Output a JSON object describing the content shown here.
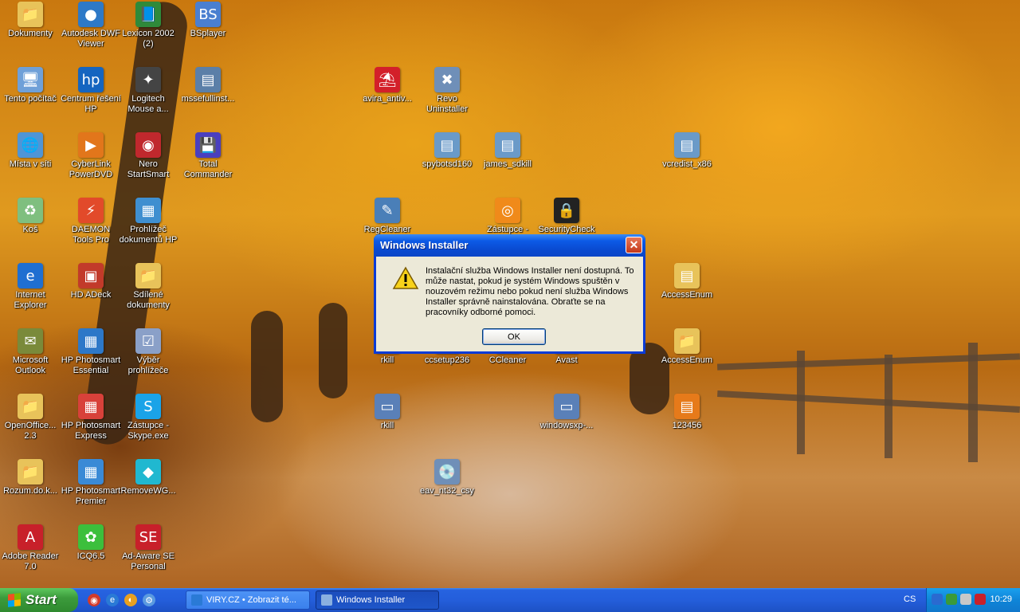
{
  "desktop": {
    "icons": [
      {
        "label": "Dokumenty",
        "glyph": "📁",
        "color": "#e8c35a"
      },
      {
        "label": "Autodesk DWF Viewer",
        "glyph": "●",
        "color": "#2d79c7"
      },
      {
        "label": "Lexicon 2002 (2)",
        "glyph": "📘",
        "color": "#2f8a3a"
      },
      {
        "label": "BSplayer",
        "glyph": "BS",
        "color": "#4a7fd0"
      },
      {
        "label": "Tento počítač",
        "glyph": "🖥",
        "color": "#6fa0d8"
      },
      {
        "label": "Centrum řešení HP",
        "glyph": "hp",
        "color": "#1565c0"
      },
      {
        "label": "Logitech Mouse a...",
        "glyph": "✦",
        "color": "#444444"
      },
      {
        "label": "mssefullinst...",
        "glyph": "▤",
        "color": "#5b7fa8"
      },
      {
        "label": "Místa v síti",
        "glyph": "🌐",
        "color": "#4f95d6"
      },
      {
        "label": "CyberLink PowerDVD",
        "glyph": "▶",
        "color": "#e2761b"
      },
      {
        "label": "Nero StartSmart",
        "glyph": "◉",
        "color": "#c0282d"
      },
      {
        "label": "Total Commander",
        "glyph": "💾",
        "color": "#4a3fbf"
      },
      {
        "label": "Koš",
        "glyph": "♻",
        "color": "#7fbf7f"
      },
      {
        "label": "DAEMON Tools Pro",
        "glyph": "⚡",
        "color": "#e24a2a"
      },
      {
        "label": "Prohlížeč dokumentů HP",
        "glyph": "▦",
        "color": "#3f8fd0"
      },
      {
        "label": "Internet Explorer",
        "glyph": "e",
        "color": "#1f6fd1"
      },
      {
        "label": "HD ADeck",
        "glyph": "▣",
        "color": "#c23a2a"
      },
      {
        "label": "Sdílené dokumenty",
        "glyph": "📁",
        "color": "#e8c35a"
      },
      {
        "label": "Microsoft Outlook",
        "glyph": "✉",
        "color": "#7a8a3a"
      },
      {
        "label": "HP Photosmart Essential",
        "glyph": "▦",
        "color": "#2d78c8"
      },
      {
        "label": "Výběr prohlížeče",
        "glyph": "☑",
        "color": "#8aa0c8"
      },
      {
        "label": "OpenOffice... 2.3",
        "glyph": "📁",
        "color": "#e8c35a"
      },
      {
        "label": "HP Photosmart Express",
        "glyph": "▦",
        "color": "#d8413a"
      },
      {
        "label": "Zástupce - Skype.exe",
        "glyph": "S",
        "color": "#1aa3e8"
      },
      {
        "label": "Rozum.do.k...",
        "glyph": "📁",
        "color": "#e8c35a"
      },
      {
        "label": "HP Photosmart Premier",
        "glyph": "▦",
        "color": "#3a8ad6"
      },
      {
        "label": "RemoveWG...",
        "glyph": "◆",
        "color": "#20b8d0"
      },
      {
        "label": "Adobe Reader 7.0",
        "glyph": "A",
        "color": "#c8202a"
      },
      {
        "label": "ICQ6.5",
        "glyph": "✿",
        "color": "#3cbf3c"
      },
      {
        "label": "Ad-Aware SE Personal",
        "glyph": "SE",
        "color": "#c8202a"
      },
      {
        "label": "avira_antiv...",
        "glyph": "⛱",
        "color": "#d3202a"
      },
      {
        "label": "Revo Uninstaller",
        "glyph": "✖",
        "color": "#6f8fb8"
      },
      {
        "label": "spybotsd160",
        "glyph": "▤",
        "color": "#6a9ac8"
      },
      {
        "label": "james_sdkill",
        "glyph": "▤",
        "color": "#6a9ac8"
      },
      {
        "label": "vcredist_x86",
        "glyph": "▤",
        "color": "#6a9ac8"
      },
      {
        "label": "RegCleaner",
        "glyph": "✎",
        "color": "#4a7fb8"
      },
      {
        "label": "Zástupce -",
        "glyph": "◎",
        "color": "#f08a1a"
      },
      {
        "label": "SecurityCheck",
        "glyph": "🔒",
        "color": "#222222"
      },
      {
        "label": "avg...",
        "glyph": "▤",
        "color": "#6a9ac8"
      },
      {
        "label": "AccessEnum",
        "glyph": "▤",
        "color": "#e8c35a"
      },
      {
        "label": "rkill",
        "glyph": "▭",
        "color": "#5a80b8"
      },
      {
        "label": "ccsetup236",
        "glyph": "▤",
        "color": "#6a9ac8"
      },
      {
        "label": "CCleaner",
        "glyph": "▤",
        "color": "#6a9ac8"
      },
      {
        "label": "Avast",
        "glyph": "▤",
        "color": "#6a9ac8"
      },
      {
        "label": "AccessEnum",
        "glyph": "📁",
        "color": "#e8c35a"
      },
      {
        "label": "rkill",
        "glyph": "▭",
        "color": "#5a80b8"
      },
      {
        "label": "windowsxp-...",
        "glyph": "▭",
        "color": "#5a80b8"
      },
      {
        "label": "123456",
        "glyph": "▤",
        "color": "#e67a1a"
      },
      {
        "label": "eav_nt32_csy",
        "glyph": "💿",
        "color": "#6f8fb8"
      }
    ]
  },
  "dialog": {
    "title": "Windows Installer",
    "message": "Instalační služba Windows Installer není dostupná. To může nastat, pokud je systém Windows spuštěn v nouzovém režimu nebo pokud není služba Windows Installer správně nainstalována. Obraťte se na pracovníky odborné pomoci.",
    "ok_label": "OK",
    "close_glyph": "✕",
    "warning_icon": "warning-icon"
  },
  "taskbar": {
    "start_label": "Start",
    "quick_launch": [
      {
        "glyph": "◉",
        "color": "#d33a2a"
      },
      {
        "glyph": "e",
        "color": "#2a7ad6"
      },
      {
        "glyph": "◐",
        "color": "#e8a020"
      },
      {
        "glyph": "⚙",
        "color": "#5a9ae0"
      }
    ],
    "tasks": [
      {
        "label": "VIRY.CZ • Zobrazit té..."
      },
      {
        "label": "Windows Installer"
      }
    ],
    "language": "CS",
    "clock": "10:29",
    "tray_icons": [
      {
        "name": "chevron-left-icon",
        "color": "#2a6ad0"
      },
      {
        "name": "network-icon",
        "color": "#3a9a3a"
      },
      {
        "name": "display-icon",
        "color": "#c8c8c8"
      },
      {
        "name": "shield-icon",
        "color": "#c8202a"
      }
    ]
  }
}
